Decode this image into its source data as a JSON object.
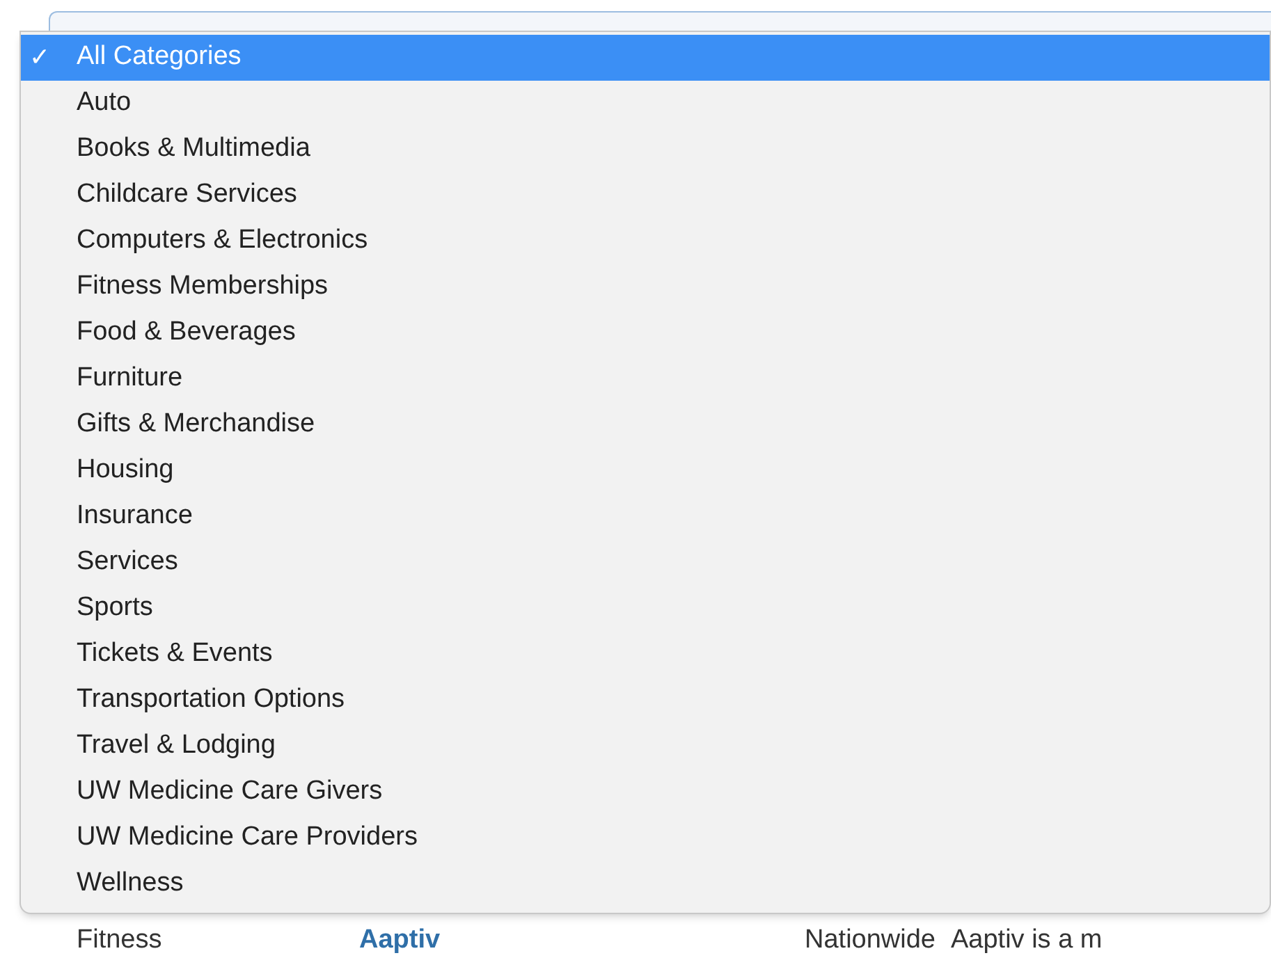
{
  "dropdown": {
    "check": "✓",
    "items": [
      {
        "label": "All Categories",
        "selected": true
      },
      {
        "label": "Auto",
        "selected": false
      },
      {
        "label": "Books & Multimedia",
        "selected": false
      },
      {
        "label": "Childcare Services",
        "selected": false
      },
      {
        "label": "Computers & Electronics",
        "selected": false
      },
      {
        "label": "Fitness Memberships",
        "selected": false
      },
      {
        "label": "Food & Beverages",
        "selected": false
      },
      {
        "label": "Furniture",
        "selected": false
      },
      {
        "label": "Gifts & Merchandise",
        "selected": false
      },
      {
        "label": "Housing",
        "selected": false
      },
      {
        "label": "Insurance",
        "selected": false
      },
      {
        "label": "Services",
        "selected": false
      },
      {
        "label": "Sports",
        "selected": false
      },
      {
        "label": "Tickets & Events",
        "selected": false
      },
      {
        "label": "Transportation Options",
        "selected": false
      },
      {
        "label": "Travel & Lodging",
        "selected": false
      },
      {
        "label": "UW Medicine Care Givers",
        "selected": false
      },
      {
        "label": "UW Medicine Care Providers",
        "selected": false
      },
      {
        "label": "Wellness",
        "selected": false
      }
    ]
  },
  "table_row": {
    "cells": [
      {
        "kind": "text",
        "text": "Fitness"
      },
      {
        "kind": "link",
        "text": "Aaptiv"
      },
      {
        "kind": "text",
        "text": "Nationwide"
      },
      {
        "kind": "text",
        "text": "Aaptiv is a m"
      }
    ]
  }
}
